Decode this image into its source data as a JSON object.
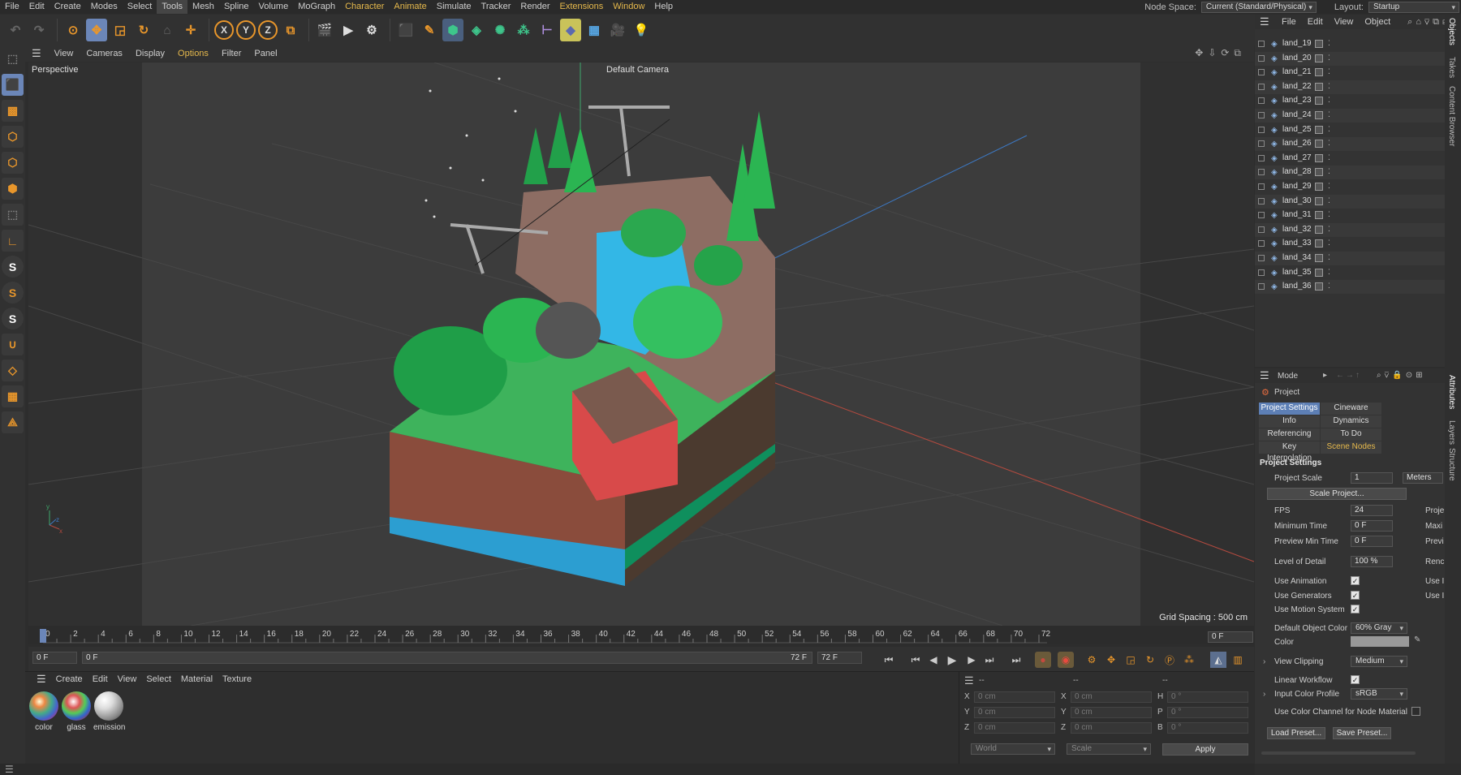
{
  "menubar": {
    "items": [
      "File",
      "Edit",
      "Create",
      "Modes",
      "Select",
      "Tools",
      "Mesh",
      "Spline",
      "Volume",
      "MoGraph",
      "Character",
      "Animate",
      "Simulate",
      "Tracker",
      "Render",
      "Extensions",
      "Window",
      "Help"
    ],
    "node_space_label": "Node Space:",
    "node_space_value": "Current (Standard/Physical)",
    "layout_label": "Layout:",
    "layout_value": "Startup"
  },
  "viewport": {
    "menu": [
      "View",
      "Cameras",
      "Display",
      "Options",
      "Filter",
      "Panel"
    ],
    "name": "Perspective",
    "camera": "Default Camera",
    "grid_spacing": "Grid Spacing : 500 cm"
  },
  "timeline": {
    "ticks": [
      "0",
      "2",
      "4",
      "6",
      "8",
      "10",
      "12",
      "14",
      "16",
      "18",
      "20",
      "22",
      "24",
      "26",
      "28",
      "30",
      "32",
      "34",
      "36",
      "38",
      "40",
      "42",
      "44",
      "46",
      "48",
      "50",
      "52",
      "54",
      "56",
      "58",
      "60",
      "62",
      "64",
      "66",
      "68",
      "70",
      "72"
    ],
    "current_frame": "0 F"
  },
  "transport": {
    "start": "0 F",
    "min": "0 F",
    "max_label": "72 F",
    "end": "72 F"
  },
  "materials": {
    "menu": [
      "Create",
      "Edit",
      "View",
      "Select",
      "Material",
      "Texture"
    ],
    "items": [
      {
        "name": "color"
      },
      {
        "name": "glass"
      },
      {
        "name": "emission"
      }
    ]
  },
  "coordinates": {
    "header": [
      "--",
      "--",
      "--"
    ],
    "rows": [
      {
        "a": "X",
        "av": "0 cm",
        "b": "X",
        "bv": "0 cm",
        "c": "H",
        "cv": "0 °"
      },
      {
        "a": "Y",
        "av": "0 cm",
        "b": "Y",
        "bv": "0 cm",
        "c": "P",
        "cv": "0 °"
      },
      {
        "a": "Z",
        "av": "0 cm",
        "b": "Z",
        "bv": "0 cm",
        "c": "B",
        "cv": "0 °"
      }
    ],
    "space": "World",
    "mode": "Scale",
    "apply": "Apply"
  },
  "objects": {
    "menu": [
      "File",
      "Edit",
      "View",
      "Object"
    ],
    "items": [
      "land_19",
      "land_20",
      "land_21",
      "land_22",
      "land_23",
      "land_24",
      "land_25",
      "land_26",
      "land_27",
      "land_28",
      "land_29",
      "land_30",
      "land_31",
      "land_32",
      "land_33",
      "land_34",
      "land_35",
      "land_36"
    ]
  },
  "side_tabs": [
    "Objects",
    "Takes",
    "Content Browser",
    "Attributes",
    "Layers",
    "Structure"
  ],
  "attributes": {
    "mode": "Mode",
    "object": "Project",
    "tabs": [
      "Project Settings",
      "Cineware",
      "Info",
      "Dynamics",
      "Referencing",
      "To Do",
      "Key Interpolation",
      "Scene Nodes"
    ],
    "section": "Project Settings",
    "project_scale_label": "Project Scale",
    "project_scale_value": "1",
    "project_scale_unit": "Meters",
    "scale_project_btn": "Scale Project...",
    "fps_label": "FPS",
    "fps_value": "24",
    "min_time_label": "Minimum Time",
    "min_time_value": "0 F",
    "preview_min_label": "Preview Min Time",
    "preview_min_value": "0 F",
    "lod_label": "Level of Detail",
    "lod_value": "100 %",
    "right_col": [
      "Proje",
      "Maxi",
      "Previ",
      "Renc",
      "Use I",
      "Use I"
    ],
    "use_animation": "Use Animation",
    "use_generators": "Use Generators",
    "use_motion": "Use Motion System",
    "default_color_label": "Default Object Color",
    "default_color_value": "60% Gray",
    "color_label": "Color",
    "view_clipping_label": "View Clipping",
    "view_clipping_value": "Medium",
    "linear_workflow": "Linear Workflow",
    "input_profile_label": "Input Color Profile",
    "input_profile_value": "sRGB",
    "use_color_channel": "Use Color Channel for Node Material",
    "load_preset": "Load Preset...",
    "save_preset": "Save Preset..."
  }
}
